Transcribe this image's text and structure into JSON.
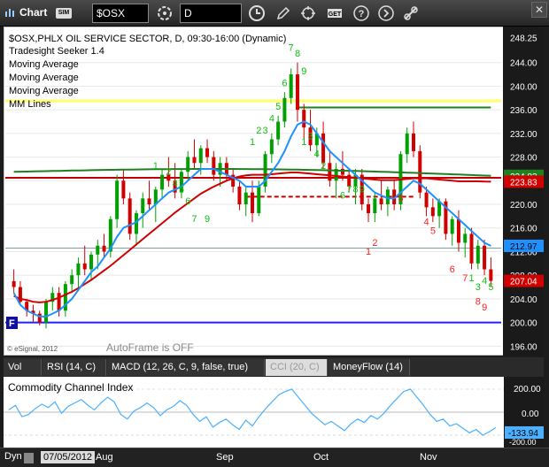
{
  "toolbar": {
    "title": "Chart",
    "sim_badge": "SIM",
    "symbol": "$OSX",
    "interval": "D",
    "icons": [
      "chart-icon",
      "refresh-cycle-icon",
      "clock-icon",
      "pencil-icon",
      "cursor-crosshair-icon",
      "get-icon",
      "help-icon",
      "chevron-right-icon",
      "link-icon"
    ],
    "close_label": "✕"
  },
  "chart_info": {
    "header": "$OSX,PHLX OIL SERVICE SECTOR, D, 09:30-16:00 (Dynamic)",
    "studies": [
      "Tradesight Seeker 1.4",
      "Moving Average",
      "Moving Average",
      "Moving Average",
      "MM Lines"
    ],
    "autoframe": "AutoFrame is OFF",
    "copyright": "© eSignal, 2012",
    "marker_f": "F"
  },
  "colors": {
    "background": "#ffffff",
    "up": "#00a000",
    "down": "#d00000",
    "ma_blue": "#1e90ff",
    "ma_red": "#d00000",
    "ma_green": "#208020",
    "mm_yellow": "#ffff66",
    "mm_blue": "#2020ff",
    "cci": "#4ab0ff"
  },
  "price_axis": {
    "labels": [
      "248.25",
      "244.00",
      "240.00",
      "236.00",
      "232.00",
      "228.00",
      "224.00",
      "220.00",
      "216.00",
      "212.00",
      "208.00",
      "204.00",
      "200.00",
      "196.00"
    ],
    "badges": [
      {
        "label": "224.83",
        "value": 224.83,
        "color": "#208020"
      },
      {
        "label": "223.83",
        "value": 223.83,
        "color": "#d00000"
      },
      {
        "label": "212.97",
        "value": 212.97,
        "color": "#1e90ff"
      },
      {
        "label": "207.04",
        "value": 207.04,
        "color": "#d00000"
      }
    ]
  },
  "x_axis": {
    "date": "07/05/2012",
    "months": [
      "Aug",
      "Sep",
      "Oct",
      "Nov"
    ]
  },
  "tabs": [
    {
      "label": "Vol",
      "active": false
    },
    {
      "label": "RSI (14, C)",
      "active": false
    },
    {
      "label": "MACD (12, 26, C, 9, false, true)",
      "active": false
    },
    {
      "label": "CCI (20, C)",
      "active": true
    },
    {
      "label": "MoneyFlow (14)",
      "active": false
    }
  ],
  "cci_pane": {
    "title": "Commodity Channel Index",
    "labels": [
      "200.00",
      "0.00",
      "-200.00"
    ],
    "badge": "-133.94"
  },
  "status": {
    "dyn": "Dyn"
  },
  "chart_data": {
    "type": "candlestick",
    "ylim": [
      195,
      249.5
    ],
    "candles": [
      [
        207,
        209,
        205,
        206
      ],
      [
        206,
        207,
        203,
        203.5
      ],
      [
        203.5,
        204,
        201,
        202
      ],
      [
        202,
        203,
        200,
        201.5
      ],
      [
        201.5,
        202,
        199.5,
        200
      ],
      [
        200,
        204,
        199,
        203.5
      ],
      [
        203.5,
        206,
        202,
        205
      ],
      [
        205,
        206,
        201,
        202
      ],
      [
        202,
        207,
        201,
        206.5
      ],
      [
        206.5,
        209,
        205,
        208
      ],
      [
        208,
        211,
        206,
        210
      ],
      [
        210,
        213,
        208,
        209
      ],
      [
        209,
        212,
        207,
        211.5
      ],
      [
        211.5,
        214,
        209,
        213
      ],
      [
        213,
        215,
        211,
        212
      ],
      [
        212,
        218,
        211,
        217.5
      ],
      [
        217.5,
        225,
        216,
        224
      ],
      [
        224,
        226,
        220,
        221
      ],
      [
        221,
        222,
        214,
        215
      ],
      [
        215,
        219,
        213,
        218.5
      ],
      [
        218.5,
        222,
        216,
        221
      ],
      [
        221,
        224,
        219,
        220
      ],
      [
        220,
        223,
        217,
        222.5
      ],
      [
        222.5,
        226,
        221,
        225
      ],
      [
        225,
        228,
        223,
        224
      ],
      [
        224,
        227,
        221,
        222
      ],
      [
        222,
        226,
        221,
        225.5
      ],
      [
        225.5,
        229,
        224,
        228
      ],
      [
        228,
        231,
        226,
        227
      ],
      [
        227,
        230,
        225,
        229.5
      ],
      [
        229.5,
        231,
        227,
        228
      ],
      [
        228,
        229,
        224,
        225
      ],
      [
        225,
        228,
        223,
        227
      ],
      [
        227,
        228,
        224,
        225
      ],
      [
        225,
        226,
        222,
        223
      ],
      [
        223,
        224,
        219,
        220
      ],
      [
        220,
        223,
        218,
        222
      ],
      [
        222,
        224,
        217,
        218.5
      ],
      [
        218.5,
        224,
        218,
        223
      ],
      [
        223,
        229,
        222,
        228.5
      ],
      [
        228.5,
        232,
        227,
        231
      ],
      [
        231,
        235,
        230,
        234
      ],
      [
        234,
        239,
        233,
        238
      ],
      [
        238,
        243,
        237,
        242
      ],
      [
        242,
        244,
        234,
        236
      ],
      [
        236,
        237,
        231,
        233
      ],
      [
        233,
        236,
        229,
        230
      ],
      [
        230,
        233,
        228,
        232
      ],
      [
        232,
        234,
        226,
        227
      ],
      [
        227,
        229,
        223,
        224
      ],
      [
        224,
        227,
        221,
        226
      ],
      [
        226,
        229,
        224,
        225
      ],
      [
        225,
        226,
        222,
        223
      ],
      [
        223,
        226,
        220,
        225
      ],
      [
        225,
        226,
        219,
        220
      ],
      [
        220,
        221,
        217,
        218.5
      ],
      [
        218.5,
        222,
        217,
        221
      ],
      [
        221,
        224,
        219,
        220
      ],
      [
        220,
        223,
        218,
        222.5
      ],
      [
        222.5,
        224,
        219,
        220
      ],
      [
        220,
        229,
        219,
        228.5
      ],
      [
        228.5,
        233,
        227,
        232
      ],
      [
        232,
        234,
        228,
        229
      ],
      [
        229,
        230,
        221,
        222
      ],
      [
        222,
        223,
        218,
        219.5
      ],
      [
        219.5,
        221,
        217,
        218
      ],
      [
        218,
        221,
        216,
        220.5
      ],
      [
        220.5,
        221,
        214,
        215
      ],
      [
        215,
        218,
        213,
        217.5
      ],
      [
        217.5,
        219,
        212,
        213.5
      ],
      [
        213.5,
        216,
        211,
        215
      ],
      [
        215,
        216,
        209,
        210
      ],
      [
        210,
        214,
        209,
        213
      ],
      [
        213,
        214,
        208,
        209
      ],
      [
        209,
        211,
        206,
        207.04
      ]
    ],
    "ma_blue": [
      205,
      203,
      202,
      201.5,
      201,
      201,
      201.5,
      202,
      203,
      204,
      205.5,
      207,
      208.5,
      209.5,
      211,
      212.5,
      214.5,
      216,
      216.5,
      217,
      218,
      219,
      220,
      221,
      222,
      222.5,
      223,
      224,
      225,
      226,
      226,
      226,
      225.5,
      225,
      224.5,
      224,
      223,
      223,
      223,
      224,
      225.5,
      227,
      229,
      231.5,
      233.5,
      234,
      233.5,
      232,
      230.5,
      229,
      228,
      227,
      226,
      225,
      224,
      223,
      222,
      221.5,
      221,
      221,
      222,
      223,
      224,
      223.5,
      222.5,
      221.5,
      220.5,
      219.5,
      218.5,
      217.5,
      216.5,
      215.5,
      214.5,
      213.5,
      212.97
    ],
    "ma_red": [
      204.5,
      204,
      203.8,
      203.5,
      203.4,
      203.5,
      203.8,
      204.2,
      204.7,
      205.2,
      205.8,
      206.5,
      207.2,
      208,
      208.8,
      209.6,
      210.5,
      211.4,
      212.3,
      213.2,
      214.1,
      215,
      215.9,
      216.8,
      217.7,
      218.6,
      219.4,
      220.2,
      221,
      221.8,
      222.4,
      223,
      223.5,
      224,
      224.4,
      224.7,
      224.9,
      225,
      225,
      225,
      225.1,
      225.2,
      225.3,
      225.4,
      225.4,
      225.3,
      225.2,
      225.1,
      225,
      224.9,
      224.8,
      224.7,
      224.6,
      224.5,
      224.4,
      224.3,
      224.2,
      224.1,
      224.1,
      224.1,
      224.2,
      224.3,
      224.4,
      224.4,
      224.4,
      224.3,
      224.2,
      224.1,
      224,
      223.9,
      223.9,
      223.9,
      223.9,
      223.85,
      223.83
    ],
    "ma_green_start": 225.5,
    "ma_green_end": 224.83,
    "mm_yellow": 237.5,
    "mm_blue": 200.0,
    "mm_red_flat": 224.5,
    "cci": [
      20,
      60,
      -40,
      -20,
      30,
      70,
      40,
      90,
      -10,
      50,
      80,
      110,
      60,
      20,
      80,
      130,
      90,
      -20,
      -60,
      10,
      40,
      80,
      40,
      -30,
      20,
      50,
      100,
      60,
      -20,
      -80,
      -40,
      -130,
      -90,
      -60,
      -110,
      -150,
      -70,
      -120,
      -40,
      30,
      90,
      150,
      180,
      200,
      130,
      60,
      -10,
      -60,
      -110,
      -80,
      -120,
      -160,
      -100,
      -60,
      -90,
      -30,
      -60,
      -10,
      60,
      120,
      180,
      200,
      130,
      60,
      -20,
      -80,
      -60,
      -120,
      -100,
      -140,
      -180,
      -150,
      -200,
      -170,
      -133.94
    ]
  }
}
